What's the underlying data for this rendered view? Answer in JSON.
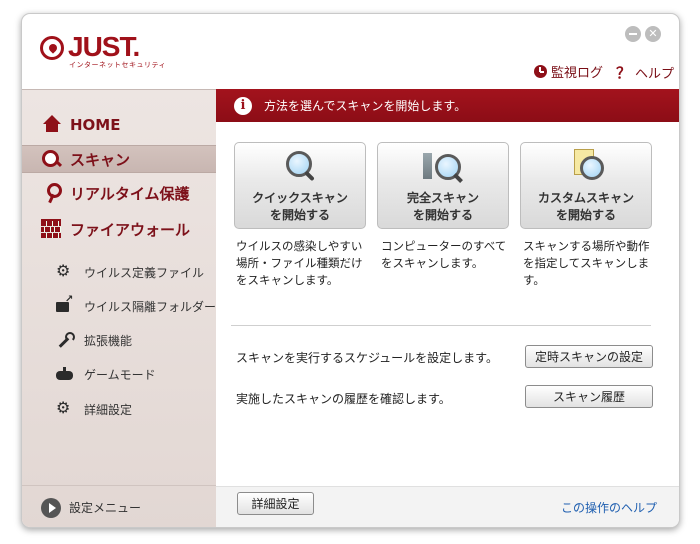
{
  "app": {
    "logo_text": "JUST.",
    "logo_sub": "インターネットセキュリティ",
    "colors": {
      "accent": "#a0111a",
      "banner": "#9c121b",
      "link": "#1f5fb0"
    }
  },
  "header": {
    "monitor_log": "監視ログ",
    "help": "ヘルプ",
    "help_mark": "？"
  },
  "sidebar": {
    "main": [
      {
        "label": "HOME",
        "icon": "home-icon"
      },
      {
        "label": "スキャン",
        "icon": "magnifier-icon"
      },
      {
        "label": "リアルタイム保護",
        "icon": "key-icon"
      },
      {
        "label": "ファイアウォール",
        "icon": "brick-wall-icon"
      }
    ],
    "sub": [
      {
        "label": "ウイルス定義ファイル",
        "icon": "gear-icon"
      },
      {
        "label": "ウイルス隔離フォルダー",
        "icon": "folder-icon"
      },
      {
        "label": "拡張機能",
        "icon": "wrench-icon"
      },
      {
        "label": "ゲームモード",
        "icon": "gamepad-icon"
      },
      {
        "label": "詳細設定",
        "icon": "gear-icon"
      }
    ],
    "bottom_label": "設定メニュー"
  },
  "main": {
    "banner_text": "方法を選んでスキャンを開始します。",
    "info_mark": "i",
    "cards": [
      {
        "line1": "クイックスキャン",
        "line2": "を開始する",
        "desc": "ウイルスの感染しやすい場所・ファイル種類だけをスキャンします。"
      },
      {
        "line1": "完全スキャン",
        "line2": "を開始する",
        "desc": "コンピューターのすべてをスキャンします。"
      },
      {
        "line1": "カスタムスキャン",
        "line2": "を開始する",
        "desc": "スキャンする場所や動作を指定してスキャンします。"
      }
    ],
    "schedule_text": "スキャンを実行するスケジュールを設定します。",
    "schedule_button": "定時スキャンの設定",
    "history_text": "実施したスキャンの履歴を確認します。",
    "history_button": "スキャン履歴"
  },
  "footer": {
    "advanced_button": "詳細設定",
    "help_link": "この操作のヘルプ"
  }
}
